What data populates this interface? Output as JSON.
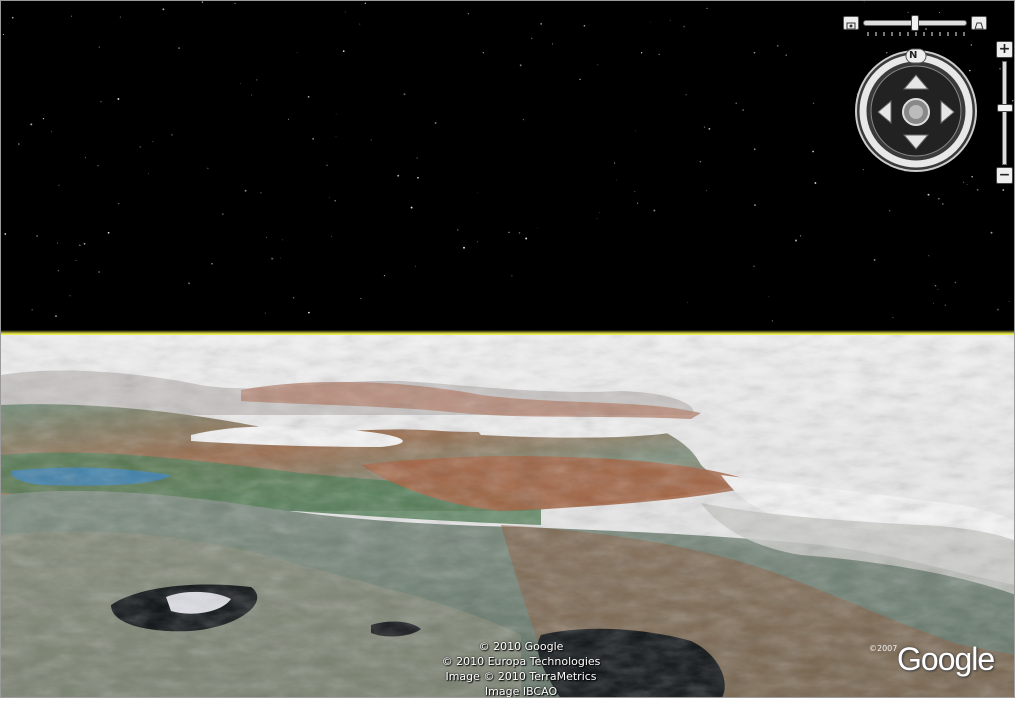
{
  "map": {
    "view": "3d-terrain",
    "sky_color": "#000000",
    "horizon_color": "#f2f24c"
  },
  "attribution": {
    "lines": [
      "© 2010 Google",
      "© 2010 Europa Technologies",
      "Image © 2010 TerraMetrics",
      "Image IBCAO"
    ]
  },
  "logo": {
    "small_copyright": "©2007",
    "text": "Google"
  },
  "navigation": {
    "compass_label": "N",
    "zoom_in_label": "+",
    "zoom_out_label": "−",
    "zoom_level": 0.45,
    "look_slider_level": 0.5,
    "icons": {
      "look_left": "look-around-icon",
      "look_right": "street-view-icon",
      "pan_up": "arrow-up-icon",
      "pan_down": "arrow-down-icon",
      "pan_left": "arrow-left-icon",
      "pan_right": "arrow-right-icon",
      "center": "joystick-icon"
    }
  }
}
